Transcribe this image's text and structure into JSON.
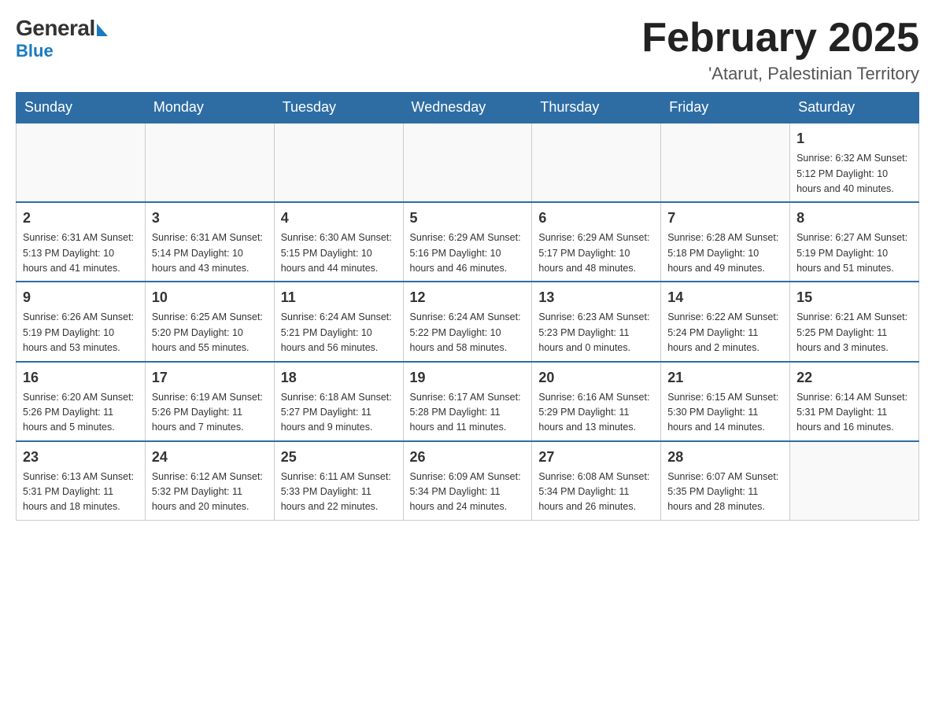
{
  "logo": {
    "general": "General",
    "blue": "Blue"
  },
  "title": "February 2025",
  "subtitle": "'Atarut, Palestinian Territory",
  "weekdays": [
    "Sunday",
    "Monday",
    "Tuesday",
    "Wednesday",
    "Thursday",
    "Friday",
    "Saturday"
  ],
  "weeks": [
    [
      {
        "day": "",
        "info": ""
      },
      {
        "day": "",
        "info": ""
      },
      {
        "day": "",
        "info": ""
      },
      {
        "day": "",
        "info": ""
      },
      {
        "day": "",
        "info": ""
      },
      {
        "day": "",
        "info": ""
      },
      {
        "day": "1",
        "info": "Sunrise: 6:32 AM\nSunset: 5:12 PM\nDaylight: 10 hours\nand 40 minutes."
      }
    ],
    [
      {
        "day": "2",
        "info": "Sunrise: 6:31 AM\nSunset: 5:13 PM\nDaylight: 10 hours\nand 41 minutes."
      },
      {
        "day": "3",
        "info": "Sunrise: 6:31 AM\nSunset: 5:14 PM\nDaylight: 10 hours\nand 43 minutes."
      },
      {
        "day": "4",
        "info": "Sunrise: 6:30 AM\nSunset: 5:15 PM\nDaylight: 10 hours\nand 44 minutes."
      },
      {
        "day": "5",
        "info": "Sunrise: 6:29 AM\nSunset: 5:16 PM\nDaylight: 10 hours\nand 46 minutes."
      },
      {
        "day": "6",
        "info": "Sunrise: 6:29 AM\nSunset: 5:17 PM\nDaylight: 10 hours\nand 48 minutes."
      },
      {
        "day": "7",
        "info": "Sunrise: 6:28 AM\nSunset: 5:18 PM\nDaylight: 10 hours\nand 49 minutes."
      },
      {
        "day": "8",
        "info": "Sunrise: 6:27 AM\nSunset: 5:19 PM\nDaylight: 10 hours\nand 51 minutes."
      }
    ],
    [
      {
        "day": "9",
        "info": "Sunrise: 6:26 AM\nSunset: 5:19 PM\nDaylight: 10 hours\nand 53 minutes."
      },
      {
        "day": "10",
        "info": "Sunrise: 6:25 AM\nSunset: 5:20 PM\nDaylight: 10 hours\nand 55 minutes."
      },
      {
        "day": "11",
        "info": "Sunrise: 6:24 AM\nSunset: 5:21 PM\nDaylight: 10 hours\nand 56 minutes."
      },
      {
        "day": "12",
        "info": "Sunrise: 6:24 AM\nSunset: 5:22 PM\nDaylight: 10 hours\nand 58 minutes."
      },
      {
        "day": "13",
        "info": "Sunrise: 6:23 AM\nSunset: 5:23 PM\nDaylight: 11 hours\nand 0 minutes."
      },
      {
        "day": "14",
        "info": "Sunrise: 6:22 AM\nSunset: 5:24 PM\nDaylight: 11 hours\nand 2 minutes."
      },
      {
        "day": "15",
        "info": "Sunrise: 6:21 AM\nSunset: 5:25 PM\nDaylight: 11 hours\nand 3 minutes."
      }
    ],
    [
      {
        "day": "16",
        "info": "Sunrise: 6:20 AM\nSunset: 5:26 PM\nDaylight: 11 hours\nand 5 minutes."
      },
      {
        "day": "17",
        "info": "Sunrise: 6:19 AM\nSunset: 5:26 PM\nDaylight: 11 hours\nand 7 minutes."
      },
      {
        "day": "18",
        "info": "Sunrise: 6:18 AM\nSunset: 5:27 PM\nDaylight: 11 hours\nand 9 minutes."
      },
      {
        "day": "19",
        "info": "Sunrise: 6:17 AM\nSunset: 5:28 PM\nDaylight: 11 hours\nand 11 minutes."
      },
      {
        "day": "20",
        "info": "Sunrise: 6:16 AM\nSunset: 5:29 PM\nDaylight: 11 hours\nand 13 minutes."
      },
      {
        "day": "21",
        "info": "Sunrise: 6:15 AM\nSunset: 5:30 PM\nDaylight: 11 hours\nand 14 minutes."
      },
      {
        "day": "22",
        "info": "Sunrise: 6:14 AM\nSunset: 5:31 PM\nDaylight: 11 hours\nand 16 minutes."
      }
    ],
    [
      {
        "day": "23",
        "info": "Sunrise: 6:13 AM\nSunset: 5:31 PM\nDaylight: 11 hours\nand 18 minutes."
      },
      {
        "day": "24",
        "info": "Sunrise: 6:12 AM\nSunset: 5:32 PM\nDaylight: 11 hours\nand 20 minutes."
      },
      {
        "day": "25",
        "info": "Sunrise: 6:11 AM\nSunset: 5:33 PM\nDaylight: 11 hours\nand 22 minutes."
      },
      {
        "day": "26",
        "info": "Sunrise: 6:09 AM\nSunset: 5:34 PM\nDaylight: 11 hours\nand 24 minutes."
      },
      {
        "day": "27",
        "info": "Sunrise: 6:08 AM\nSunset: 5:34 PM\nDaylight: 11 hours\nand 26 minutes."
      },
      {
        "day": "28",
        "info": "Sunrise: 6:07 AM\nSunset: 5:35 PM\nDaylight: 11 hours\nand 28 minutes."
      },
      {
        "day": "",
        "info": ""
      }
    ]
  ]
}
